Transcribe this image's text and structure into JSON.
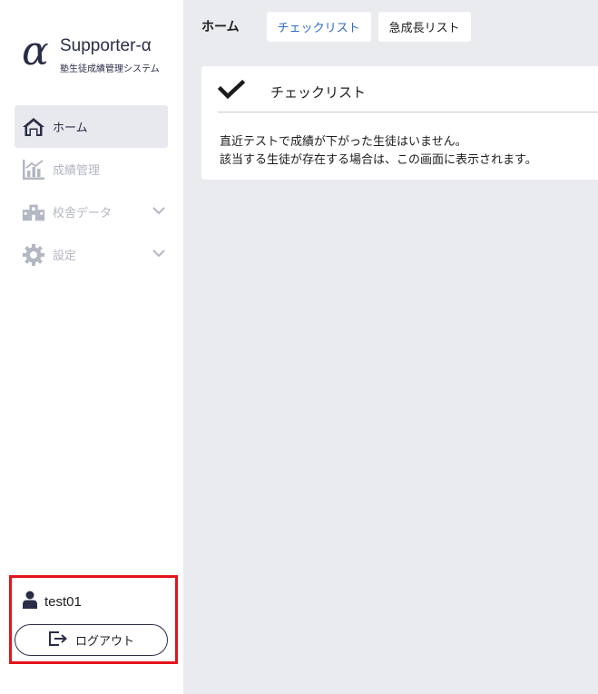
{
  "brand": {
    "logo": "α",
    "name": "Supporter-α",
    "subtitle": "塾生徒成績管理システム"
  },
  "sidebar": {
    "items": [
      {
        "label": "ホーム",
        "icon": "home-icon",
        "active": true
      },
      {
        "label": "成績管理",
        "icon": "chart-icon",
        "active": false
      },
      {
        "label": "校舎データ",
        "icon": "building-icon",
        "active": false,
        "expandable": true
      },
      {
        "label": "設定",
        "icon": "gear-icon",
        "active": false,
        "expandable": true
      }
    ]
  },
  "user": {
    "name": "test01",
    "logout_label": "ログアウト"
  },
  "header": {
    "title": "ホーム",
    "tabs": [
      {
        "label": "チェックリスト",
        "active": true
      },
      {
        "label": "急成長リスト",
        "active": false
      }
    ]
  },
  "card": {
    "title": "チェックリスト",
    "lines": [
      "直近テストで成績が下がった生徒はいません。",
      "該当する生徒が存在する場合は、この画面に表示されます。"
    ]
  },
  "colors": {
    "accent": "#2f6dbf",
    "brand": "#2a2d48",
    "highlight_border": "#e3141b",
    "background": "#e9ebef",
    "nav_inactive": "#b3b7c2"
  }
}
